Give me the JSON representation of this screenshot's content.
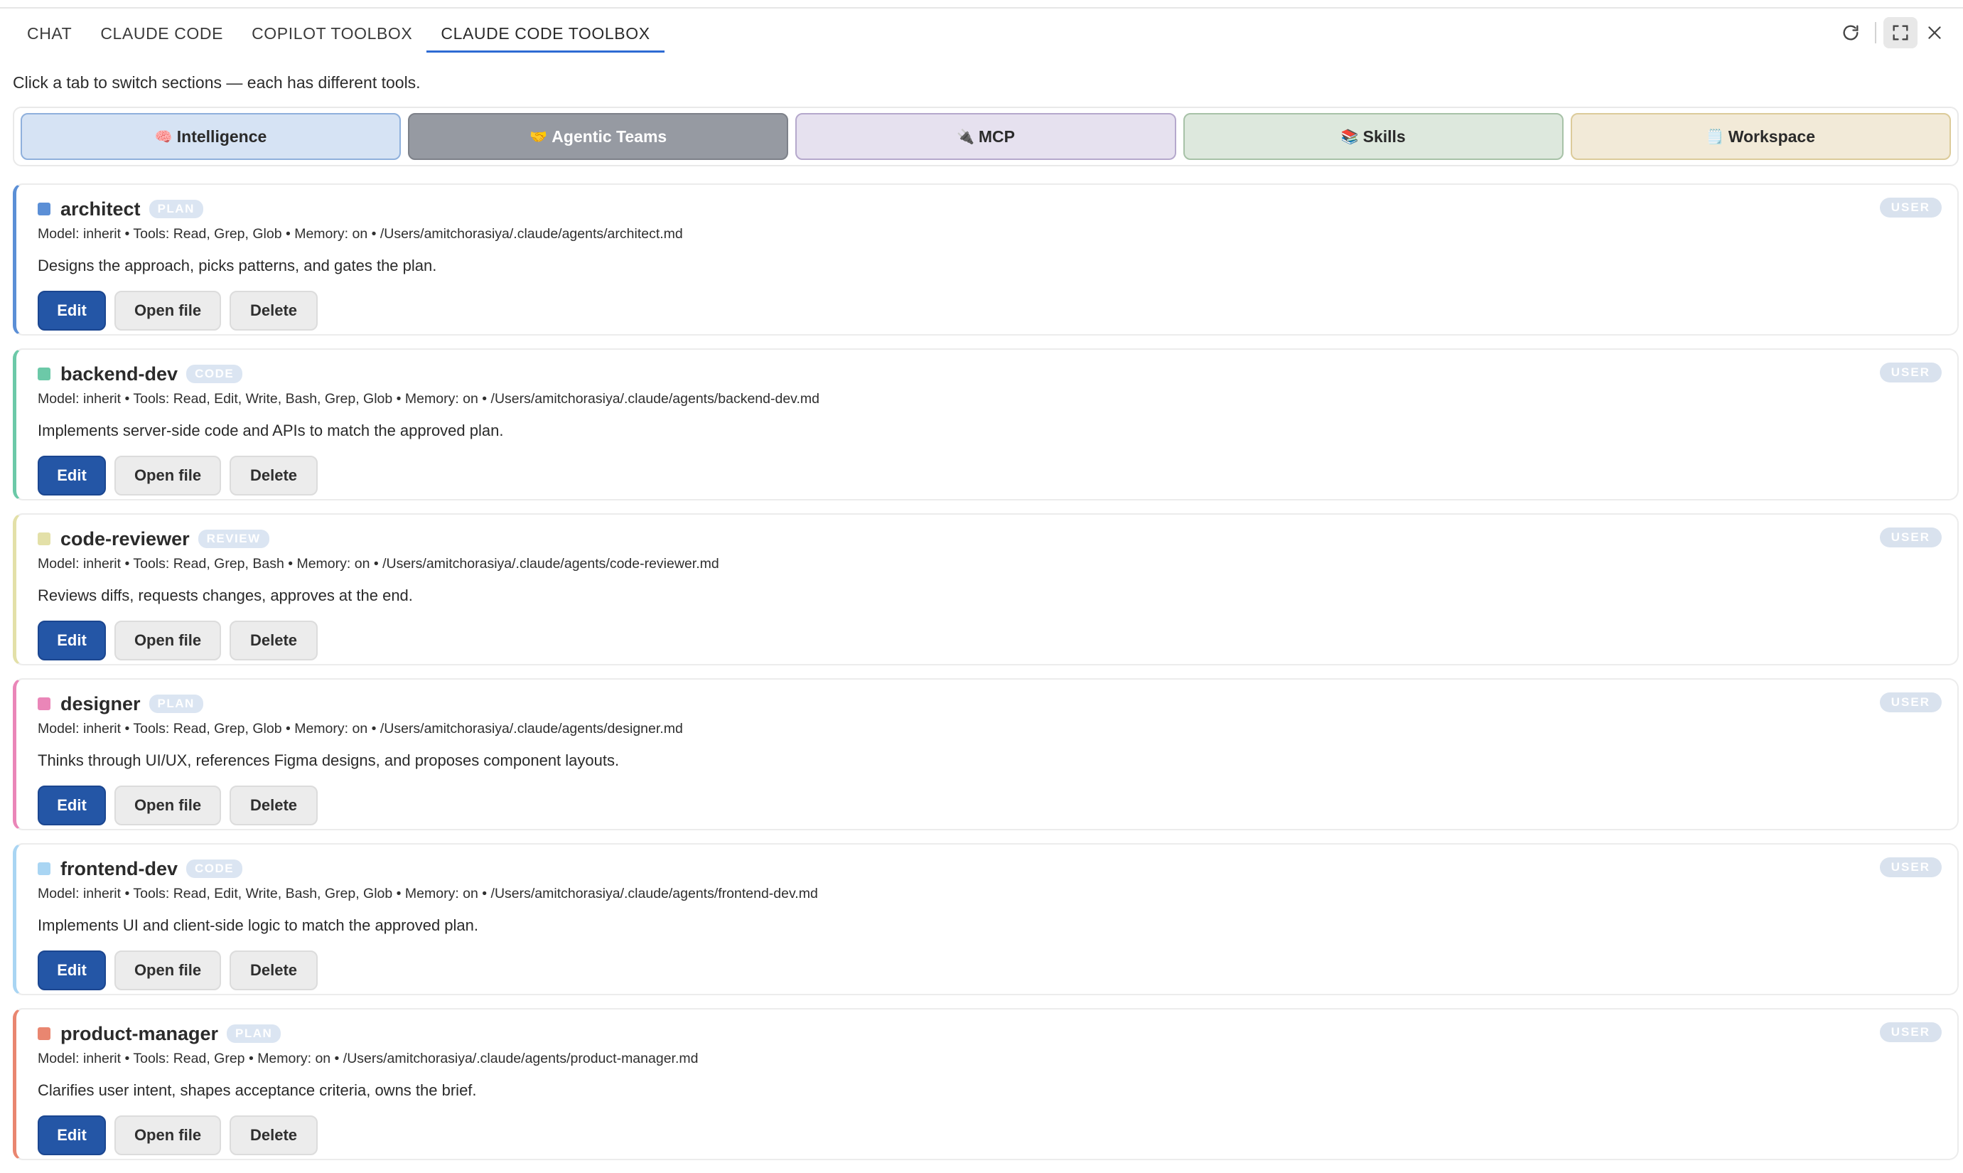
{
  "tabs": [
    {
      "label": "CHAT"
    },
    {
      "label": "CLAUDE CODE"
    },
    {
      "label": "COPILOT TOOLBOX"
    },
    {
      "label": "CLAUDE CODE TOOLBOX",
      "active": true
    }
  ],
  "window_controls": [
    "refresh-icon",
    "fullscreen-icon",
    "close-icon"
  ],
  "hint": "Click a tab to switch sections — each has different tools.",
  "sections": [
    {
      "emoji": "🧠",
      "label": "Intelligence",
      "bg": "#d6e3f4",
      "border": "#8fb0dc"
    },
    {
      "emoji": "🤝",
      "label": "Agentic Teams",
      "bg": "#969aa2",
      "border": "#7d8189",
      "active": true
    },
    {
      "emoji": "🔌",
      "label": "MCP",
      "bg": "#e6e1ef",
      "border": "#b5a8cc"
    },
    {
      "emoji": "📚",
      "label": "Skills",
      "bg": "#dde8dd",
      "border": "#a7c2a7"
    },
    {
      "emoji": "🗒️",
      "label": "Workspace",
      "bg": "#f2ead8",
      "border": "#dccb9a"
    }
  ],
  "buttons": {
    "edit": "Edit",
    "open": "Open file",
    "delete": "Delete"
  },
  "agents": [
    {
      "name": "architect",
      "kind": "PLAN",
      "scope": "USER",
      "color": "#5b8fd6",
      "meta": "Model: inherit • Tools: Read, Grep, Glob • Memory: on • /Users/amitchorasiya/.claude/agents/architect.md",
      "description": "Designs the approach, picks patterns, and gates the plan."
    },
    {
      "name": "backend-dev",
      "kind": "CODE",
      "scope": "USER",
      "color": "#6cc9a8",
      "meta": "Model: inherit • Tools: Read, Edit, Write, Bash, Grep, Glob • Memory: on • /Users/amitchorasiya/.claude/agents/backend-dev.md",
      "description": "Implements server-side code and APIs to match the approved plan."
    },
    {
      "name": "code-reviewer",
      "kind": "REVIEW",
      "scope": "USER",
      "color": "#e3e0a8",
      "meta": "Model: inherit • Tools: Read, Grep, Bash • Memory: on • /Users/amitchorasiya/.claude/agents/code-reviewer.md",
      "description": "Reviews diffs, requests changes, approves at the end."
    },
    {
      "name": "designer",
      "kind": "PLAN",
      "scope": "USER",
      "color": "#ea86b8",
      "meta": "Model: inherit • Tools: Read, Grep, Glob • Memory: on • /Users/amitchorasiya/.claude/agents/designer.md",
      "description": "Thinks through UI/UX, references Figma designs, and proposes component layouts."
    },
    {
      "name": "frontend-dev",
      "kind": "CODE",
      "scope": "USER",
      "color": "#a9d5f3",
      "meta": "Model: inherit • Tools: Read, Edit, Write, Bash, Grep, Glob • Memory: on • /Users/amitchorasiya/.claude/agents/frontend-dev.md",
      "description": "Implements UI and client-side logic to match the approved plan."
    },
    {
      "name": "product-manager",
      "kind": "PLAN",
      "scope": "USER",
      "color": "#e98670",
      "meta": "Model: inherit • Tools: Read, Grep • Memory: on • /Users/amitchorasiya/.claude/agents/product-manager.md",
      "description": "Clarifies user intent, shapes acceptance criteria, owns the brief."
    }
  ]
}
